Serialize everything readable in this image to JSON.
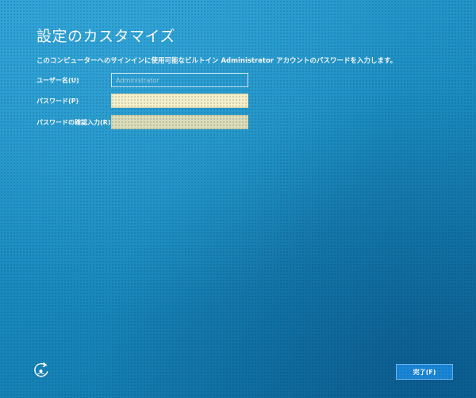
{
  "page": {
    "title": "設定のカスタマイズ",
    "instruction": "このコンピューターへのサインインに使用可能なビルトイン Administrator アカウントのパスワードを入力します。"
  },
  "form": {
    "username": {
      "label": "ユーザー名(U)",
      "value": "",
      "placeholder": "Administrator"
    },
    "password": {
      "label": "パスワード(P)",
      "value": ""
    },
    "confirm_password": {
      "label": "パスワードの確認入力(R)",
      "value": ""
    }
  },
  "footer": {
    "finish_label": "完了(F)",
    "accessibility_icon": "ease-of-access-icon"
  },
  "colors": {
    "background": "#1e8fbf",
    "button": "#1a86d6",
    "password_field": "#f6efc8"
  }
}
